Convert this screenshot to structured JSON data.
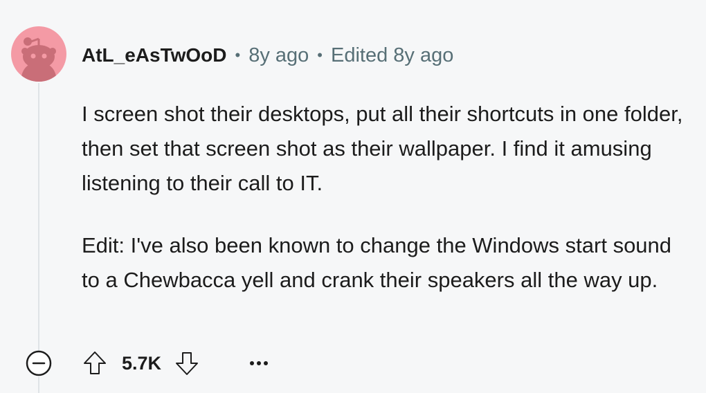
{
  "comment": {
    "author": "AtL_eAsTwOoD",
    "separator": "•",
    "age": "8y ago",
    "edited": "Edited 8y ago",
    "paragraphs": [
      "I screen shot their desktops, put all their shortcuts in one folder, then set that screen shot as their wallpaper. I find it amusing listening to their call to IT.",
      "Edit: I've also been known to change the Windows start sound to a Chewbacca yell and crank their speakers all the way up."
    ],
    "score": "5.7K"
  },
  "icons": {
    "avatar": "snoo-avatar",
    "collapse": "minus-circle-icon",
    "upvote": "upvote-arrow-icon",
    "downvote": "downvote-arrow-icon",
    "more": "ellipsis-icon"
  },
  "colors": {
    "background": "#f6f7f8",
    "avatar_bg": "#f49aa5",
    "meta_text": "#576f76",
    "text": "#1c1c1c"
  }
}
